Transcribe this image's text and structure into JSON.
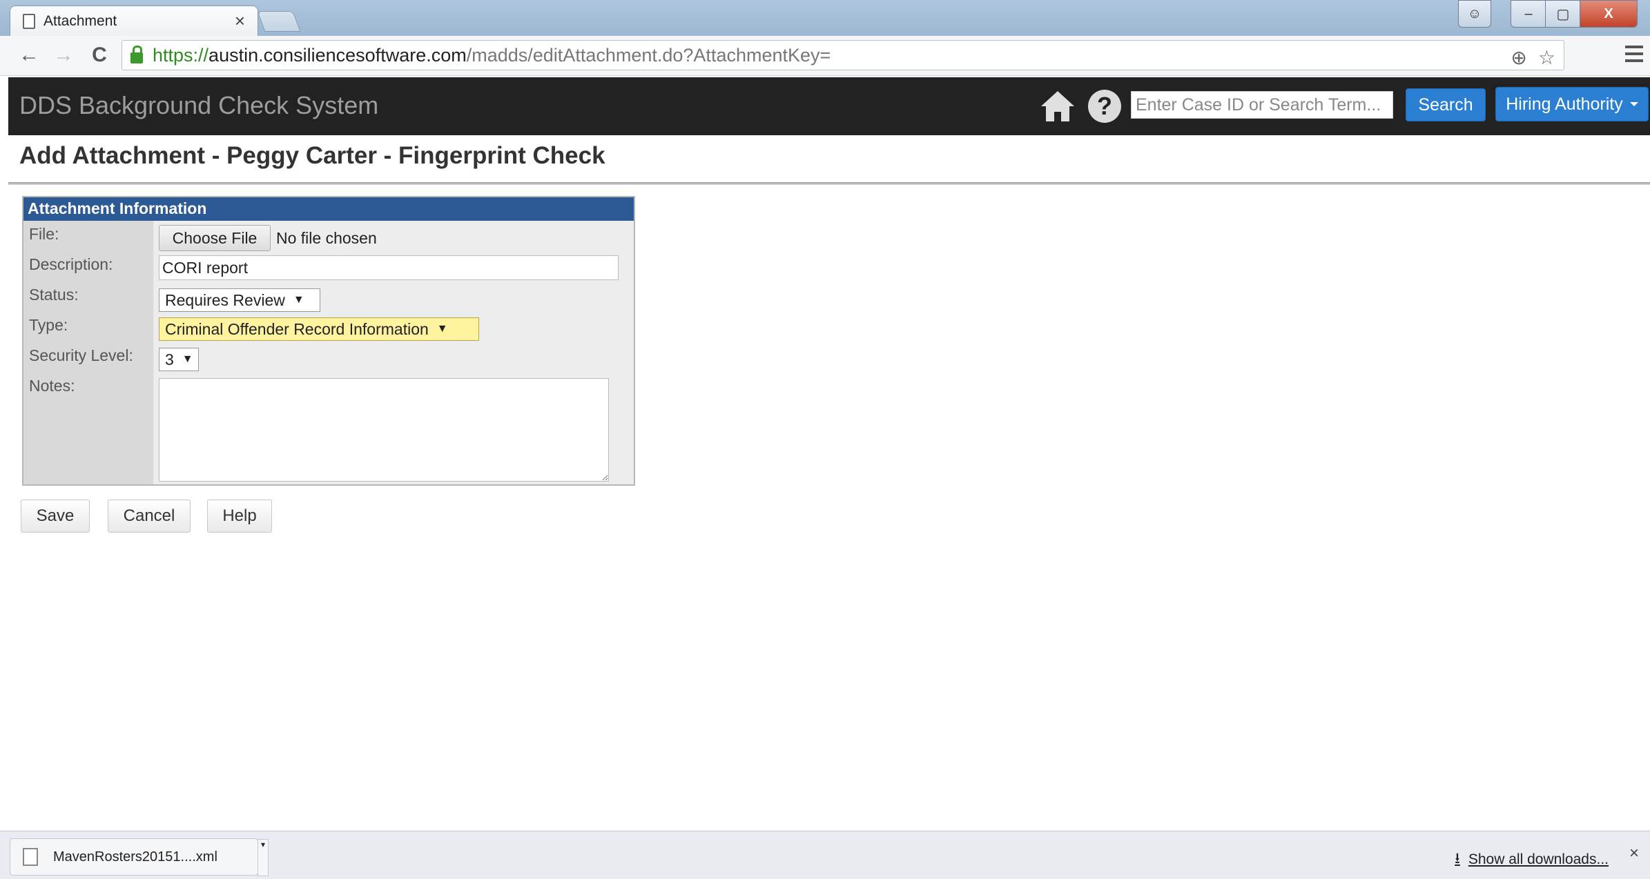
{
  "browser": {
    "tab_title": "Attachment",
    "tab_close": "×",
    "url_scheme": "https://",
    "url_host": "austin.consiliencesoftware.com",
    "url_path": "/madds/editAttachment.do?AttachmentKey=",
    "win_close": "X"
  },
  "app": {
    "brand": "DDS Background Check System",
    "search_placeholder": "Enter Case ID or Search Term...",
    "search_button": "Search",
    "role_button": "Hiring Authority"
  },
  "page": {
    "title": "Add Attachment - Peggy Carter - Fingerprint Check"
  },
  "form": {
    "header": "Attachment Information",
    "labels": {
      "file": "File:",
      "description": "Description:",
      "status": "Status:",
      "type": "Type:",
      "security": "Security Level:",
      "notes": "Notes:"
    },
    "file_button": "Choose File",
    "file_status": "No file chosen",
    "description_value": "CORI report",
    "status_value": "Requires Review",
    "type_value": "Criminal Offender Record Information",
    "security_value": "3",
    "notes_value": ""
  },
  "actions": {
    "save": "Save",
    "cancel": "Cancel",
    "help": "Help"
  },
  "downloads": {
    "file_name": "MavenRosters20151....xml",
    "show_all": "Show all downloads...",
    "close": "×"
  },
  "colors": {
    "appbar_bg": "#222222",
    "primary_button": "#2a7fd2",
    "panel_header": "#2c5a95",
    "type_highlight": "#fff3a0"
  }
}
